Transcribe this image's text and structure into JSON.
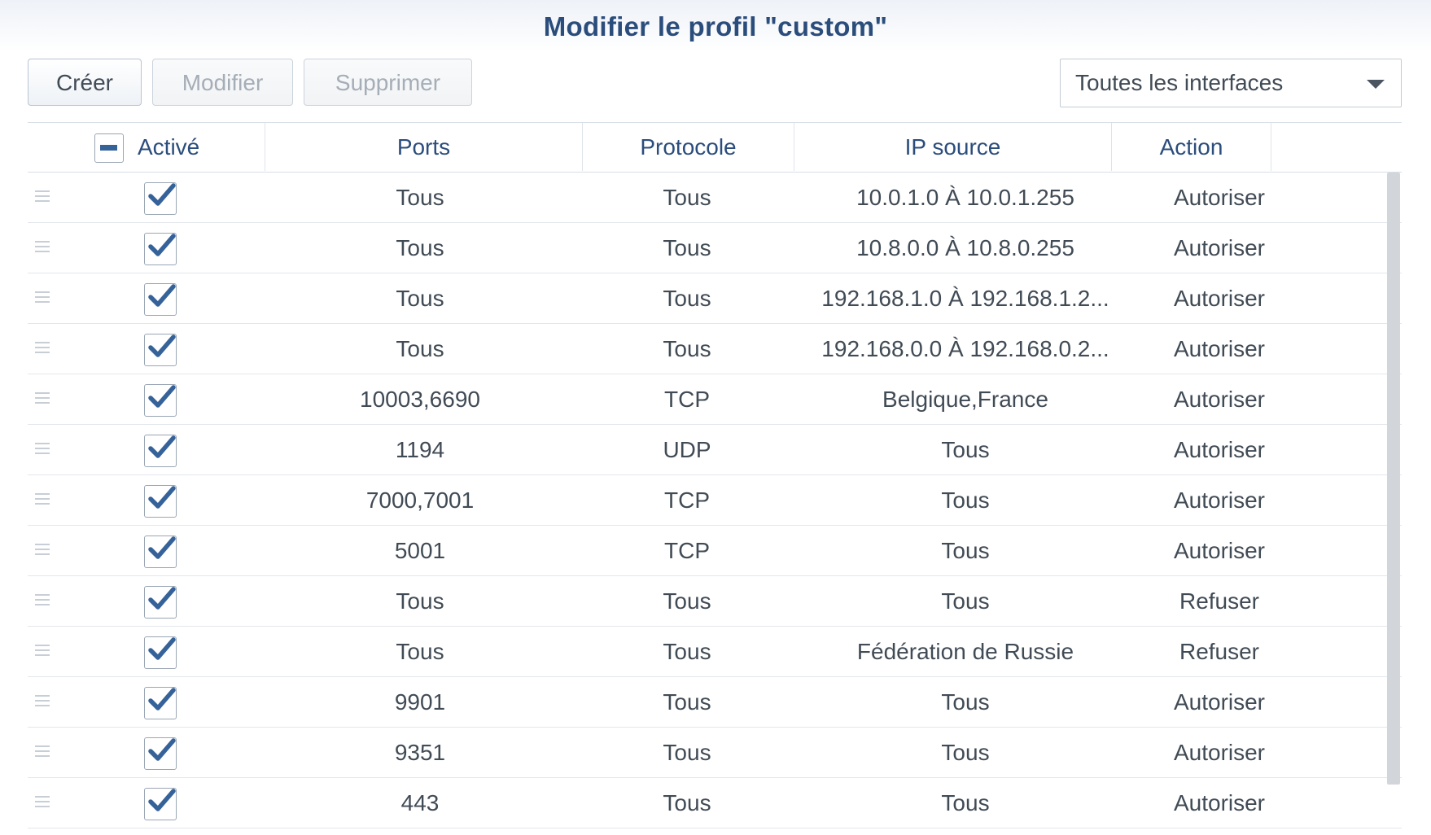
{
  "dialog": {
    "title": "Modifier le profil \"custom\""
  },
  "toolbar": {
    "create_label": "Créer",
    "edit_label": "Modifier",
    "delete_label": "Supprimer",
    "interface_filter": "Toutes les interfaces"
  },
  "table": {
    "columns": [
      "Activé",
      "Ports",
      "Protocole",
      "IP source",
      "Action"
    ],
    "rows": [
      {
        "enabled": true,
        "ports": "Tous",
        "protocol": "Tous",
        "source_ip": "10.0.1.0 À 10.0.1.255",
        "action": "Autoriser"
      },
      {
        "enabled": true,
        "ports": "Tous",
        "protocol": "Tous",
        "source_ip": "10.8.0.0 À 10.8.0.255",
        "action": "Autoriser"
      },
      {
        "enabled": true,
        "ports": "Tous",
        "protocol": "Tous",
        "source_ip": "192.168.1.0 À 192.168.1.2...",
        "action": "Autoriser"
      },
      {
        "enabled": true,
        "ports": "Tous",
        "protocol": "Tous",
        "source_ip": "192.168.0.0 À 192.168.0.2...",
        "action": "Autoriser"
      },
      {
        "enabled": true,
        "ports": "10003,6690",
        "protocol": "TCP",
        "source_ip": "Belgique,France",
        "action": "Autoriser"
      },
      {
        "enabled": true,
        "ports": "1194",
        "protocol": "UDP",
        "source_ip": "Tous",
        "action": "Autoriser"
      },
      {
        "enabled": true,
        "ports": "7000,7001",
        "protocol": "TCP",
        "source_ip": "Tous",
        "action": "Autoriser"
      },
      {
        "enabled": true,
        "ports": "5001",
        "protocol": "TCP",
        "source_ip": "Tous",
        "action": "Autoriser"
      },
      {
        "enabled": true,
        "ports": "Tous",
        "protocol": "Tous",
        "source_ip": "Tous",
        "action": "Refuser"
      },
      {
        "enabled": true,
        "ports": "Tous",
        "protocol": "Tous",
        "source_ip": "Fédération de Russie",
        "action": "Refuser"
      },
      {
        "enabled": true,
        "ports": "9901",
        "protocol": "Tous",
        "source_ip": "Tous",
        "action": "Autoriser"
      },
      {
        "enabled": true,
        "ports": "9351",
        "protocol": "Tous",
        "source_ip": "Tous",
        "action": "Autoriser"
      },
      {
        "enabled": true,
        "ports": "443",
        "protocol": "Tous",
        "source_ip": "Tous",
        "action": "Autoriser"
      }
    ]
  },
  "colors": {
    "accent": "#2b4d7c",
    "checkbox": "#36629a",
    "text": "#414b55"
  },
  "icons": {
    "drag": "drag-handle-icon",
    "check": "checkmark-icon",
    "caret": "chevron-down-icon",
    "indeterminate": "minus-icon"
  }
}
